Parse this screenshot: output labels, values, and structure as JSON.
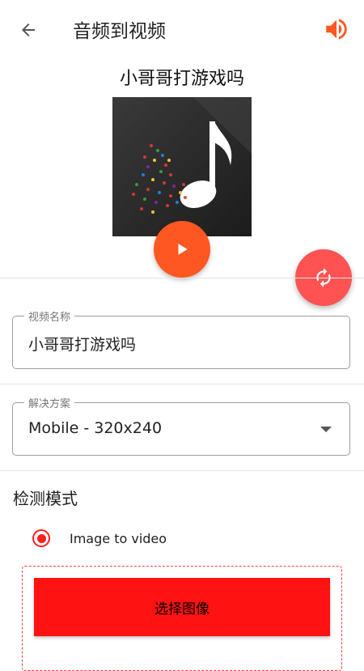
{
  "appbar": {
    "title": "音频到视频",
    "back_icon": "arrow-left-icon",
    "volume_icon": "volume-icon",
    "accent_color": "#ff5722"
  },
  "track": {
    "title": "小哥哥打游戏吗",
    "cover_icon": "music-note-icon",
    "play_icon": "play-icon"
  },
  "refresh_icon": "refresh-icon",
  "video_name": {
    "label": "视频名称",
    "value": "小哥哥打游戏吗"
  },
  "resolution": {
    "label": "解决方案",
    "selected": "Mobile - 320x240"
  },
  "detection": {
    "heading": "检测模式",
    "option_label": "Image to video",
    "selected": true
  },
  "select_image_button": "选择图像",
  "colors": {
    "play_button": "#ff5722",
    "fab": "#ff5252",
    "primary_button": "#ff1212",
    "radio": "#ff1e1e"
  }
}
